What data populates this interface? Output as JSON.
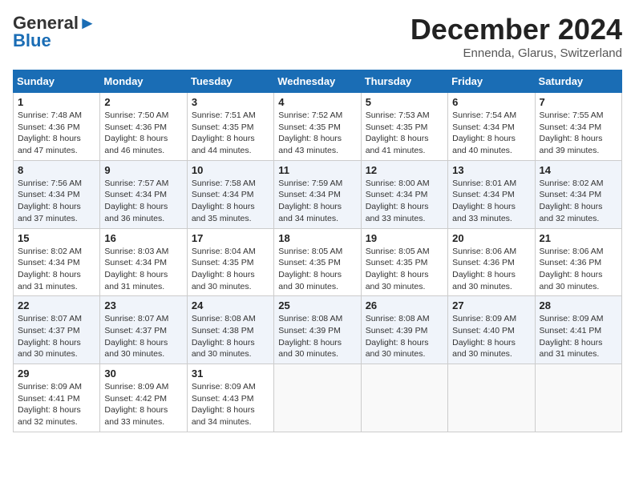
{
  "header": {
    "logo_line1": "General",
    "logo_line2": "Blue",
    "month": "December 2024",
    "location": "Ennenda, Glarus, Switzerland"
  },
  "weekdays": [
    "Sunday",
    "Monday",
    "Tuesday",
    "Wednesday",
    "Thursday",
    "Friday",
    "Saturday"
  ],
  "weeks": [
    [
      {
        "day": 1,
        "sunrise": "7:48 AM",
        "sunset": "4:36 PM",
        "daylight": "8 hours and 47 minutes."
      },
      {
        "day": 2,
        "sunrise": "7:50 AM",
        "sunset": "4:36 PM",
        "daylight": "8 hours and 46 minutes."
      },
      {
        "day": 3,
        "sunrise": "7:51 AM",
        "sunset": "4:35 PM",
        "daylight": "8 hours and 44 minutes."
      },
      {
        "day": 4,
        "sunrise": "7:52 AM",
        "sunset": "4:35 PM",
        "daylight": "8 hours and 43 minutes."
      },
      {
        "day": 5,
        "sunrise": "7:53 AM",
        "sunset": "4:35 PM",
        "daylight": "8 hours and 41 minutes."
      },
      {
        "day": 6,
        "sunrise": "7:54 AM",
        "sunset": "4:34 PM",
        "daylight": "8 hours and 40 minutes."
      },
      {
        "day": 7,
        "sunrise": "7:55 AM",
        "sunset": "4:34 PM",
        "daylight": "8 hours and 39 minutes."
      }
    ],
    [
      {
        "day": 8,
        "sunrise": "7:56 AM",
        "sunset": "4:34 PM",
        "daylight": "8 hours and 37 minutes."
      },
      {
        "day": 9,
        "sunrise": "7:57 AM",
        "sunset": "4:34 PM",
        "daylight": "8 hours and 36 minutes."
      },
      {
        "day": 10,
        "sunrise": "7:58 AM",
        "sunset": "4:34 PM",
        "daylight": "8 hours and 35 minutes."
      },
      {
        "day": 11,
        "sunrise": "7:59 AM",
        "sunset": "4:34 PM",
        "daylight": "8 hours and 34 minutes."
      },
      {
        "day": 12,
        "sunrise": "8:00 AM",
        "sunset": "4:34 PM",
        "daylight": "8 hours and 33 minutes."
      },
      {
        "day": 13,
        "sunrise": "8:01 AM",
        "sunset": "4:34 PM",
        "daylight": "8 hours and 33 minutes."
      },
      {
        "day": 14,
        "sunrise": "8:02 AM",
        "sunset": "4:34 PM",
        "daylight": "8 hours and 32 minutes."
      }
    ],
    [
      {
        "day": 15,
        "sunrise": "8:02 AM",
        "sunset": "4:34 PM",
        "daylight": "8 hours and 31 minutes."
      },
      {
        "day": 16,
        "sunrise": "8:03 AM",
        "sunset": "4:34 PM",
        "daylight": "8 hours and 31 minutes."
      },
      {
        "day": 17,
        "sunrise": "8:04 AM",
        "sunset": "4:35 PM",
        "daylight": "8 hours and 30 minutes."
      },
      {
        "day": 18,
        "sunrise": "8:05 AM",
        "sunset": "4:35 PM",
        "daylight": "8 hours and 30 minutes."
      },
      {
        "day": 19,
        "sunrise": "8:05 AM",
        "sunset": "4:35 PM",
        "daylight": "8 hours and 30 minutes."
      },
      {
        "day": 20,
        "sunrise": "8:06 AM",
        "sunset": "4:36 PM",
        "daylight": "8 hours and 30 minutes."
      },
      {
        "day": 21,
        "sunrise": "8:06 AM",
        "sunset": "4:36 PM",
        "daylight": "8 hours and 30 minutes."
      }
    ],
    [
      {
        "day": 22,
        "sunrise": "8:07 AM",
        "sunset": "4:37 PM",
        "daylight": "8 hours and 30 minutes."
      },
      {
        "day": 23,
        "sunrise": "8:07 AM",
        "sunset": "4:37 PM",
        "daylight": "8 hours and 30 minutes."
      },
      {
        "day": 24,
        "sunrise": "8:08 AM",
        "sunset": "4:38 PM",
        "daylight": "8 hours and 30 minutes."
      },
      {
        "day": 25,
        "sunrise": "8:08 AM",
        "sunset": "4:39 PM",
        "daylight": "8 hours and 30 minutes."
      },
      {
        "day": 26,
        "sunrise": "8:08 AM",
        "sunset": "4:39 PM",
        "daylight": "8 hours and 30 minutes."
      },
      {
        "day": 27,
        "sunrise": "8:09 AM",
        "sunset": "4:40 PM",
        "daylight": "8 hours and 30 minutes."
      },
      {
        "day": 28,
        "sunrise": "8:09 AM",
        "sunset": "4:41 PM",
        "daylight": "8 hours and 31 minutes."
      }
    ],
    [
      {
        "day": 29,
        "sunrise": "8:09 AM",
        "sunset": "4:41 PM",
        "daylight": "8 hours and 32 minutes."
      },
      {
        "day": 30,
        "sunrise": "8:09 AM",
        "sunset": "4:42 PM",
        "daylight": "8 hours and 33 minutes."
      },
      {
        "day": 31,
        "sunrise": "8:09 AM",
        "sunset": "4:43 PM",
        "daylight": "8 hours and 34 minutes."
      },
      null,
      null,
      null,
      null
    ]
  ]
}
